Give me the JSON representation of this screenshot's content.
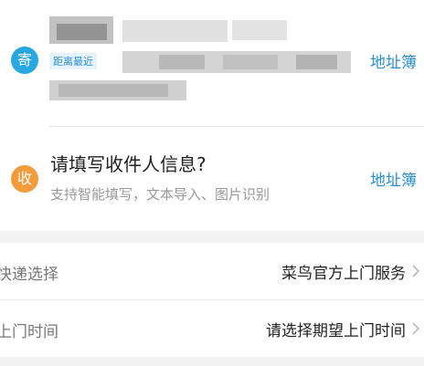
{
  "sender": {
    "badge": "寄",
    "tag": "距离最近",
    "address_book": "地址簿"
  },
  "receiver": {
    "badge": "收",
    "title": "请填写收件人信息?",
    "subtitle": "支持智能填写，文本导入、图片识别",
    "address_book": "地址簿"
  },
  "courier": {
    "label": "快递选择",
    "value": "菜鸟官方上门服务"
  },
  "pickup_time": {
    "label": "上门时间",
    "value": "请选择期望上门时间"
  },
  "colors": {
    "send_badge": "#29a7e1",
    "recv_badge": "#f39a3a",
    "link": "#2a8fd6"
  }
}
